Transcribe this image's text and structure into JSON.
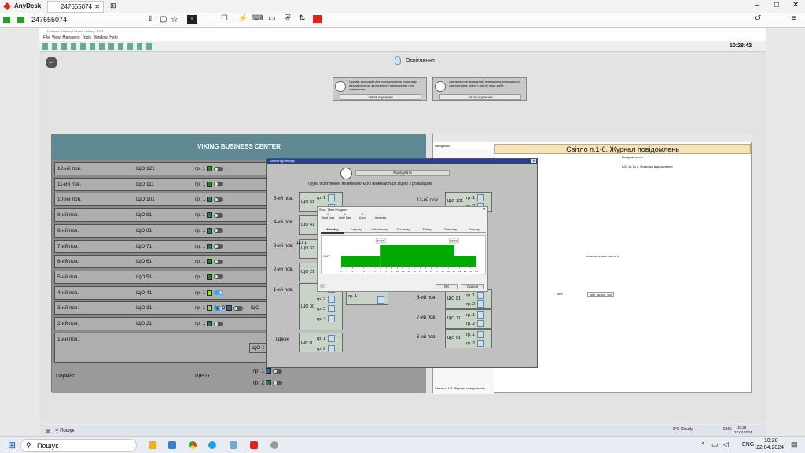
{
  "anydesk": {
    "app": "AnyDesk",
    "session_tab": "247655074",
    "address": "247655074",
    "monitor": "1"
  },
  "remote": {
    "window_title": "Reliance 4 Control Server - Viking - PC1",
    "menu": [
      "File",
      "View",
      "Managers",
      "Tools",
      "Window",
      "Help"
    ],
    "clock": "10:28:42"
  },
  "page": {
    "title": "Освітлення"
  },
  "cards": [
    {
      "text": "Часова програма для налаштування розкладу автоматичного включення / виключення груп освітлення",
      "button": "Налаштування"
    },
    {
      "text": "Автоматичне вмикання / вимикання зовнішнього освітлення в темну і світлу пору доби",
      "button": "Налаштування"
    }
  ],
  "floor_panel": {
    "header": "VIKING BUSINESS CENTER",
    "rows": [
      {
        "floor": "12-ий пов.",
        "shield": "ЩО 121",
        "group": "гр. 1"
      },
      {
        "floor": "11-ий пов.",
        "shield": "ЩО 111",
        "group": "гр. 1"
      },
      {
        "floor": "10-ий пов.",
        "shield": "ЩО 101",
        "group": "гр. 1"
      },
      {
        "floor": "9-ий пов.",
        "shield": "ЩО 91",
        "group": "гр. 1"
      },
      {
        "floor": "8-ий пов.",
        "shield": "ЩО 81",
        "group": "гр. 1"
      },
      {
        "floor": "7-ий пов.",
        "shield": "ЩО 71",
        "group": "гр. 1"
      },
      {
        "floor": "6-ий пов.",
        "shield": "ЩО 61",
        "group": "гр. 1"
      },
      {
        "floor": "5-ий пов.",
        "shield": "ЩО 51",
        "group": "гр. 1"
      },
      {
        "floor": "4-ий пов.",
        "shield": "ЩО 41",
        "group": "гр. 1"
      },
      {
        "floor": "3-ий пов.",
        "shield": "ЩО 31",
        "group": "гр. 1"
      },
      {
        "floor": "2-ий пов.",
        "shield": "ЩО 21",
        "group": "гр. 1"
      },
      {
        "floor": "1-ий пов.",
        "shield": "",
        "group": ""
      }
    ],
    "row3_group2": "гр. 2",
    "row3_shield2": "ЩО",
    "row1_shield": "ЩО 1",
    "parking": {
      "label": "Паркінг",
      "shield": "ЩР П",
      "g1": "гр. 1",
      "g2": "гр. 2"
    }
  },
  "journal": {
    "title": "Світло п.1-6. Журнал повідомлень",
    "nav": "Navigation",
    "col_msg": "Повідомлення",
    "entry": "ЩО.1т. 5з 2. Помилка відмовлення",
    "loaded": "Loaded record count: 1",
    "col_time": "Time",
    "col_tag": "light_action_bot",
    "footer": "Світло п.1-6. Журнал повідомлень"
  },
  "tps": {
    "title": "TimeProgSettings",
    "edit": "Редагувати",
    "caption": "Групи освітлення, які вмикаються і вимикаються згідно з розкладом",
    "left": [
      {
        "f": "5-ий пов.",
        "s": "ЩО 51",
        "g": [
          "гр. 1",
          "гр. 2"
        ]
      },
      {
        "f": "4-ий пов.",
        "s": "ЩО 41",
        "g": []
      },
      {
        "f": "3-ий пов.",
        "s": "ЩО 31",
        "g": []
      },
      {
        "f": "2-ий пов.",
        "s": "ЩО 21",
        "g": []
      },
      {
        "f": "1-ий пов.",
        "s": "ЩО 30",
        "g": [
          "гр. 1",
          "гр. 2",
          "гр. 3",
          "гр. 4"
        ]
      },
      {
        "f": "Паркінг",
        "s": "ЩР П",
        "g": [
          "гр. 1",
          "гр. 2"
        ]
      }
    ],
    "right": [
      {
        "f": "12-ий пов.",
        "s": "ЩО 121",
        "g": [
          "гр. 1",
          "гр. 2"
        ]
      },
      {
        "f": "8-ий пов.",
        "s": "ЩО 81",
        "g": [
          "гр. 1",
          "гр. 2"
        ]
      },
      {
        "f": "7-ий пов.",
        "s": "ЩО 71",
        "g": [
          "гр. 1",
          "гр. 2"
        ]
      },
      {
        "f": "6-ий пов.",
        "s": "ЩО 61",
        "g": [
          "гр. 1",
          "гр. 2"
        ]
      }
    ],
    "mid": {
      "s": "ЩО 1",
      "g": "гр. 1"
    }
  },
  "timeprog": {
    "title": "Ѕсо - Time Program",
    "tools": [
      "Read Data",
      "Write Data",
      "Copy",
      "Generate"
    ],
    "days": [
      "Monday",
      "Tuesday",
      "Wednesday",
      "Thursday",
      "Friday",
      "Saturday",
      "Sunday"
    ],
    "off": "OUT",
    "t1": "07:00",
    "t2": "20:00",
    "ok": "OK",
    "cancel": "Cancel",
    "hours": [
      "0",
      "1",
      "2",
      "3",
      "4",
      "5",
      "6",
      "7",
      "8",
      "9",
      "10",
      "11",
      "12",
      "13",
      "14",
      "15",
      "16",
      "17",
      "18",
      "19",
      "20",
      "21",
      "22",
      "23",
      "24"
    ]
  },
  "taskbar": {
    "search": "Пошук",
    "weather": "6°C Cloudy",
    "lang": "ENG",
    "time": "10:28",
    "date": "22.04.2024",
    "inner_time": "10:28",
    "inner_date": "22.04.2024",
    "inner_search": "Пошук",
    "inner_lang": "ENG"
  }
}
